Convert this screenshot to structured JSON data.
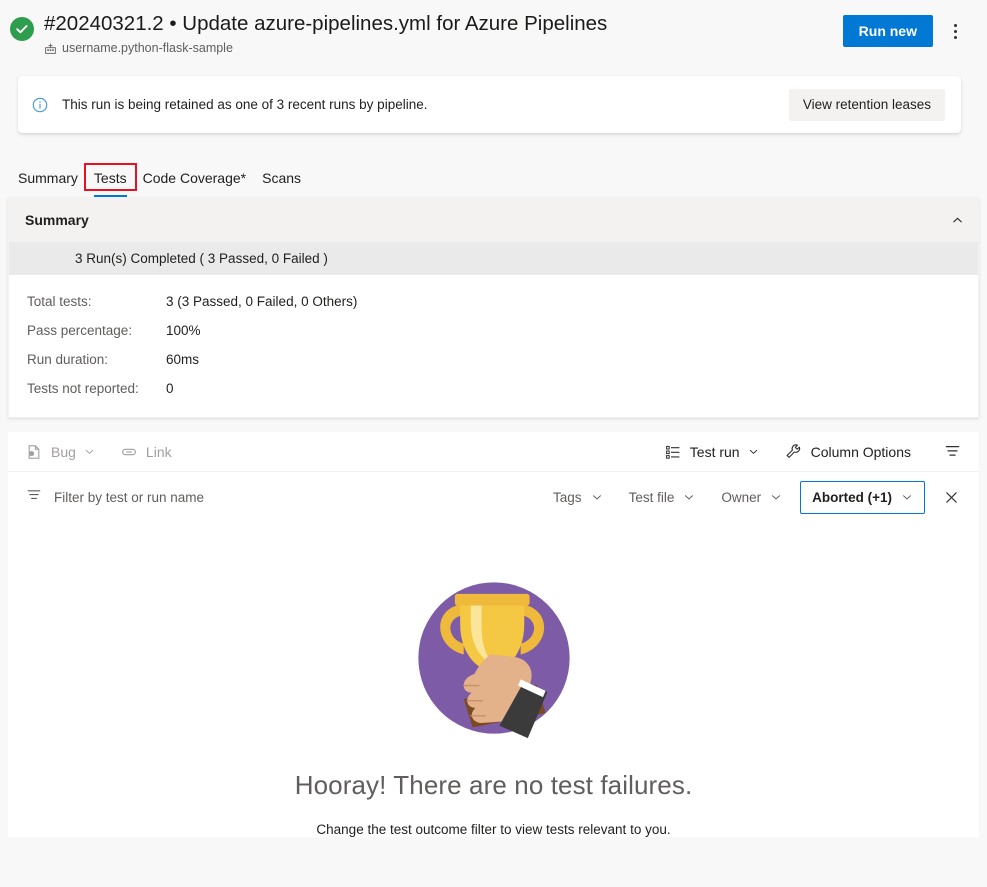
{
  "header": {
    "status_icon": "success-check-icon",
    "status_color": "#2e9e4e",
    "title": "#20240321.2 • Update azure-pipelines.yml for Azure Pipelines",
    "repo_icon": "pipeline-repo-icon",
    "repo_name": "username.python-flask-sample",
    "run_new_label": "Run new",
    "more_actions_icon": "kebab-menu-icon",
    "accent_color": "#0078d4"
  },
  "banner": {
    "icon": "info-circle-icon",
    "message": "This run is being retained as one of 3 recent runs by pipeline.",
    "action_label": "View retention leases"
  },
  "tabs": [
    {
      "label": "Summary",
      "active": false,
      "annotated": false
    },
    {
      "label": "Tests",
      "active": true,
      "annotated": true
    },
    {
      "label": "Code Coverage*",
      "active": false,
      "annotated": false
    },
    {
      "label": "Scans",
      "active": false,
      "annotated": false
    }
  ],
  "annotation_color": "#e81123",
  "summary": {
    "section_title": "Summary",
    "collapse_icon": "chevron-up-icon",
    "runs_line": "3 Run(s) Completed ( 3 Passed, 0 Failed )",
    "rows": [
      {
        "key": "Total tests:",
        "value": "3 (3 Passed, 0 Failed, 0 Others)"
      },
      {
        "key": "Pass percentage:",
        "value": "100%"
      },
      {
        "key": "Run duration:",
        "value": "60ms"
      },
      {
        "key": "Tests not reported:",
        "value": "0"
      }
    ]
  },
  "toolbar": {
    "bug_label": "Bug",
    "bug_icon": "bug-icon",
    "bug_chevron_icon": "chevron-down-icon",
    "link_label": "Link",
    "link_icon": "link-icon",
    "test_run_label": "Test run",
    "test_run_icon": "grouping-list-icon",
    "test_run_chevron_icon": "chevron-down-icon",
    "column_options_label": "Column Options",
    "column_options_icon": "wrench-icon",
    "filter_toggle_icon": "filter-icon"
  },
  "filterbar": {
    "filter_icon": "filter-icon",
    "filter_placeholder": "Filter by test or run name",
    "filter_value": "",
    "pills": [
      {
        "label": "Tags",
        "active": false,
        "chevron_icon": "chevron-down-icon"
      },
      {
        "label": "Test file",
        "active": false,
        "chevron_icon": "chevron-down-icon"
      },
      {
        "label": "Owner",
        "active": false,
        "chevron_icon": "chevron-down-icon"
      },
      {
        "label": "Aborted (+1)",
        "active": true,
        "chevron_icon": "chevron-down-icon"
      }
    ],
    "close_icon": "close-x-icon"
  },
  "empty_state": {
    "illustration": "trophy-held-in-hand-illustration",
    "circle_color": "#7d5ba6",
    "trophy_color": "#f4c842",
    "title": "Hooray! There are no test failures.",
    "subtitle": "Change the test outcome filter to view tests relevant to you."
  }
}
